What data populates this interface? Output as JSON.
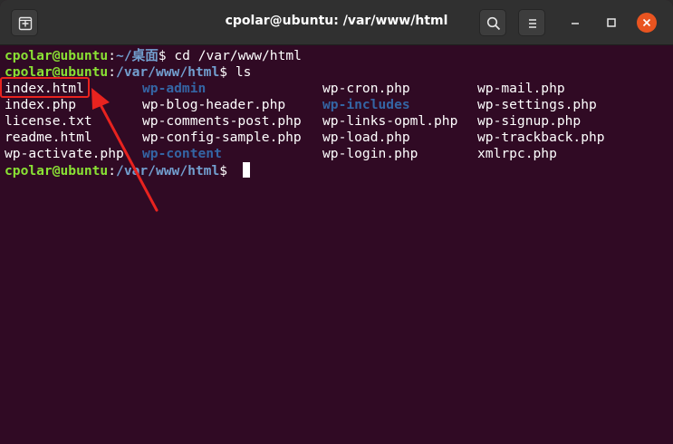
{
  "window": {
    "title": "cpolar@ubuntu: /var/www/html",
    "icons": [
      "new-tab-icon",
      "search-icon",
      "hamburger-menu-icon",
      "minimize-icon",
      "maximize-icon",
      "close-icon"
    ],
    "close_color": "#e95420"
  },
  "terminal": {
    "background": "#300a24",
    "prompt_user": "cpolar@ubuntu",
    "lines": [
      {
        "user": "cpolar@ubuntu",
        "sep": ":",
        "path": "~/桌面",
        "symbol": "$ ",
        "cmd": "cd /var/www/html"
      },
      {
        "user": "cpolar@ubuntu",
        "sep": ":",
        "path": "/var/www/html",
        "symbol": "$ ",
        "cmd": "ls"
      }
    ],
    "ls_rows": [
      [
        "index.html",
        "wp-admin",
        "wp-cron.php",
        "wp-mail.php"
      ],
      [
        "index.php",
        "wp-blog-header.php",
        "wp-includes",
        "wp-settings.php"
      ],
      [
        "license.txt",
        "wp-comments-post.php",
        "wp-links-opml.php",
        "wp-signup.php"
      ],
      [
        "readme.html",
        "wp-config-sample.php",
        "wp-load.php",
        "wp-trackback.php"
      ],
      [
        "wp-activate.php",
        "wp-content",
        "wp-login.php",
        "xmlrpc.php"
      ]
    ],
    "directories": [
      "wp-admin",
      "wp-includes",
      "wp-content"
    ],
    "final_prompt": {
      "user": "cpolar@ubuntu",
      "sep": ":",
      "path": "/var/www/html",
      "symbol": "$ "
    }
  },
  "annotation": {
    "highlighted_item": "index.html",
    "color": "#e8231f"
  }
}
